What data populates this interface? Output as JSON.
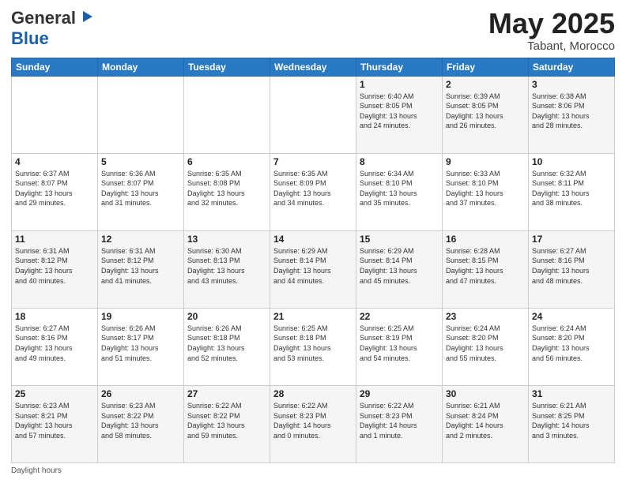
{
  "header": {
    "logo_general": "General",
    "logo_blue": "Blue",
    "title": "May 2025",
    "location": "Tabant, Morocco"
  },
  "days_of_week": [
    "Sunday",
    "Monday",
    "Tuesday",
    "Wednesday",
    "Thursday",
    "Friday",
    "Saturday"
  ],
  "weeks": [
    [
      {
        "day": "",
        "info": ""
      },
      {
        "day": "",
        "info": ""
      },
      {
        "day": "",
        "info": ""
      },
      {
        "day": "",
        "info": ""
      },
      {
        "day": "1",
        "info": "Sunrise: 6:40 AM\nSunset: 8:05 PM\nDaylight: 13 hours\nand 24 minutes."
      },
      {
        "day": "2",
        "info": "Sunrise: 6:39 AM\nSunset: 8:05 PM\nDaylight: 13 hours\nand 26 minutes."
      },
      {
        "day": "3",
        "info": "Sunrise: 6:38 AM\nSunset: 8:06 PM\nDaylight: 13 hours\nand 28 minutes."
      }
    ],
    [
      {
        "day": "4",
        "info": "Sunrise: 6:37 AM\nSunset: 8:07 PM\nDaylight: 13 hours\nand 29 minutes."
      },
      {
        "day": "5",
        "info": "Sunrise: 6:36 AM\nSunset: 8:07 PM\nDaylight: 13 hours\nand 31 minutes."
      },
      {
        "day": "6",
        "info": "Sunrise: 6:35 AM\nSunset: 8:08 PM\nDaylight: 13 hours\nand 32 minutes."
      },
      {
        "day": "7",
        "info": "Sunrise: 6:35 AM\nSunset: 8:09 PM\nDaylight: 13 hours\nand 34 minutes."
      },
      {
        "day": "8",
        "info": "Sunrise: 6:34 AM\nSunset: 8:10 PM\nDaylight: 13 hours\nand 35 minutes."
      },
      {
        "day": "9",
        "info": "Sunrise: 6:33 AM\nSunset: 8:10 PM\nDaylight: 13 hours\nand 37 minutes."
      },
      {
        "day": "10",
        "info": "Sunrise: 6:32 AM\nSunset: 8:11 PM\nDaylight: 13 hours\nand 38 minutes."
      }
    ],
    [
      {
        "day": "11",
        "info": "Sunrise: 6:31 AM\nSunset: 8:12 PM\nDaylight: 13 hours\nand 40 minutes."
      },
      {
        "day": "12",
        "info": "Sunrise: 6:31 AM\nSunset: 8:12 PM\nDaylight: 13 hours\nand 41 minutes."
      },
      {
        "day": "13",
        "info": "Sunrise: 6:30 AM\nSunset: 8:13 PM\nDaylight: 13 hours\nand 43 minutes."
      },
      {
        "day": "14",
        "info": "Sunrise: 6:29 AM\nSunset: 8:14 PM\nDaylight: 13 hours\nand 44 minutes."
      },
      {
        "day": "15",
        "info": "Sunrise: 6:29 AM\nSunset: 8:14 PM\nDaylight: 13 hours\nand 45 minutes."
      },
      {
        "day": "16",
        "info": "Sunrise: 6:28 AM\nSunset: 8:15 PM\nDaylight: 13 hours\nand 47 minutes."
      },
      {
        "day": "17",
        "info": "Sunrise: 6:27 AM\nSunset: 8:16 PM\nDaylight: 13 hours\nand 48 minutes."
      }
    ],
    [
      {
        "day": "18",
        "info": "Sunrise: 6:27 AM\nSunset: 8:16 PM\nDaylight: 13 hours\nand 49 minutes."
      },
      {
        "day": "19",
        "info": "Sunrise: 6:26 AM\nSunset: 8:17 PM\nDaylight: 13 hours\nand 51 minutes."
      },
      {
        "day": "20",
        "info": "Sunrise: 6:26 AM\nSunset: 8:18 PM\nDaylight: 13 hours\nand 52 minutes."
      },
      {
        "day": "21",
        "info": "Sunrise: 6:25 AM\nSunset: 8:18 PM\nDaylight: 13 hours\nand 53 minutes."
      },
      {
        "day": "22",
        "info": "Sunrise: 6:25 AM\nSunset: 8:19 PM\nDaylight: 13 hours\nand 54 minutes."
      },
      {
        "day": "23",
        "info": "Sunrise: 6:24 AM\nSunset: 8:20 PM\nDaylight: 13 hours\nand 55 minutes."
      },
      {
        "day": "24",
        "info": "Sunrise: 6:24 AM\nSunset: 8:20 PM\nDaylight: 13 hours\nand 56 minutes."
      }
    ],
    [
      {
        "day": "25",
        "info": "Sunrise: 6:23 AM\nSunset: 8:21 PM\nDaylight: 13 hours\nand 57 minutes."
      },
      {
        "day": "26",
        "info": "Sunrise: 6:23 AM\nSunset: 8:22 PM\nDaylight: 13 hours\nand 58 minutes."
      },
      {
        "day": "27",
        "info": "Sunrise: 6:22 AM\nSunset: 8:22 PM\nDaylight: 13 hours\nand 59 minutes."
      },
      {
        "day": "28",
        "info": "Sunrise: 6:22 AM\nSunset: 8:23 PM\nDaylight: 14 hours\nand 0 minutes."
      },
      {
        "day": "29",
        "info": "Sunrise: 6:22 AM\nSunset: 8:23 PM\nDaylight: 14 hours\nand 1 minute."
      },
      {
        "day": "30",
        "info": "Sunrise: 6:21 AM\nSunset: 8:24 PM\nDaylight: 14 hours\nand 2 minutes."
      },
      {
        "day": "31",
        "info": "Sunrise: 6:21 AM\nSunset: 8:25 PM\nDaylight: 14 hours\nand 3 minutes."
      }
    ]
  ],
  "footer": {
    "daylight_hours": "Daylight hours"
  }
}
